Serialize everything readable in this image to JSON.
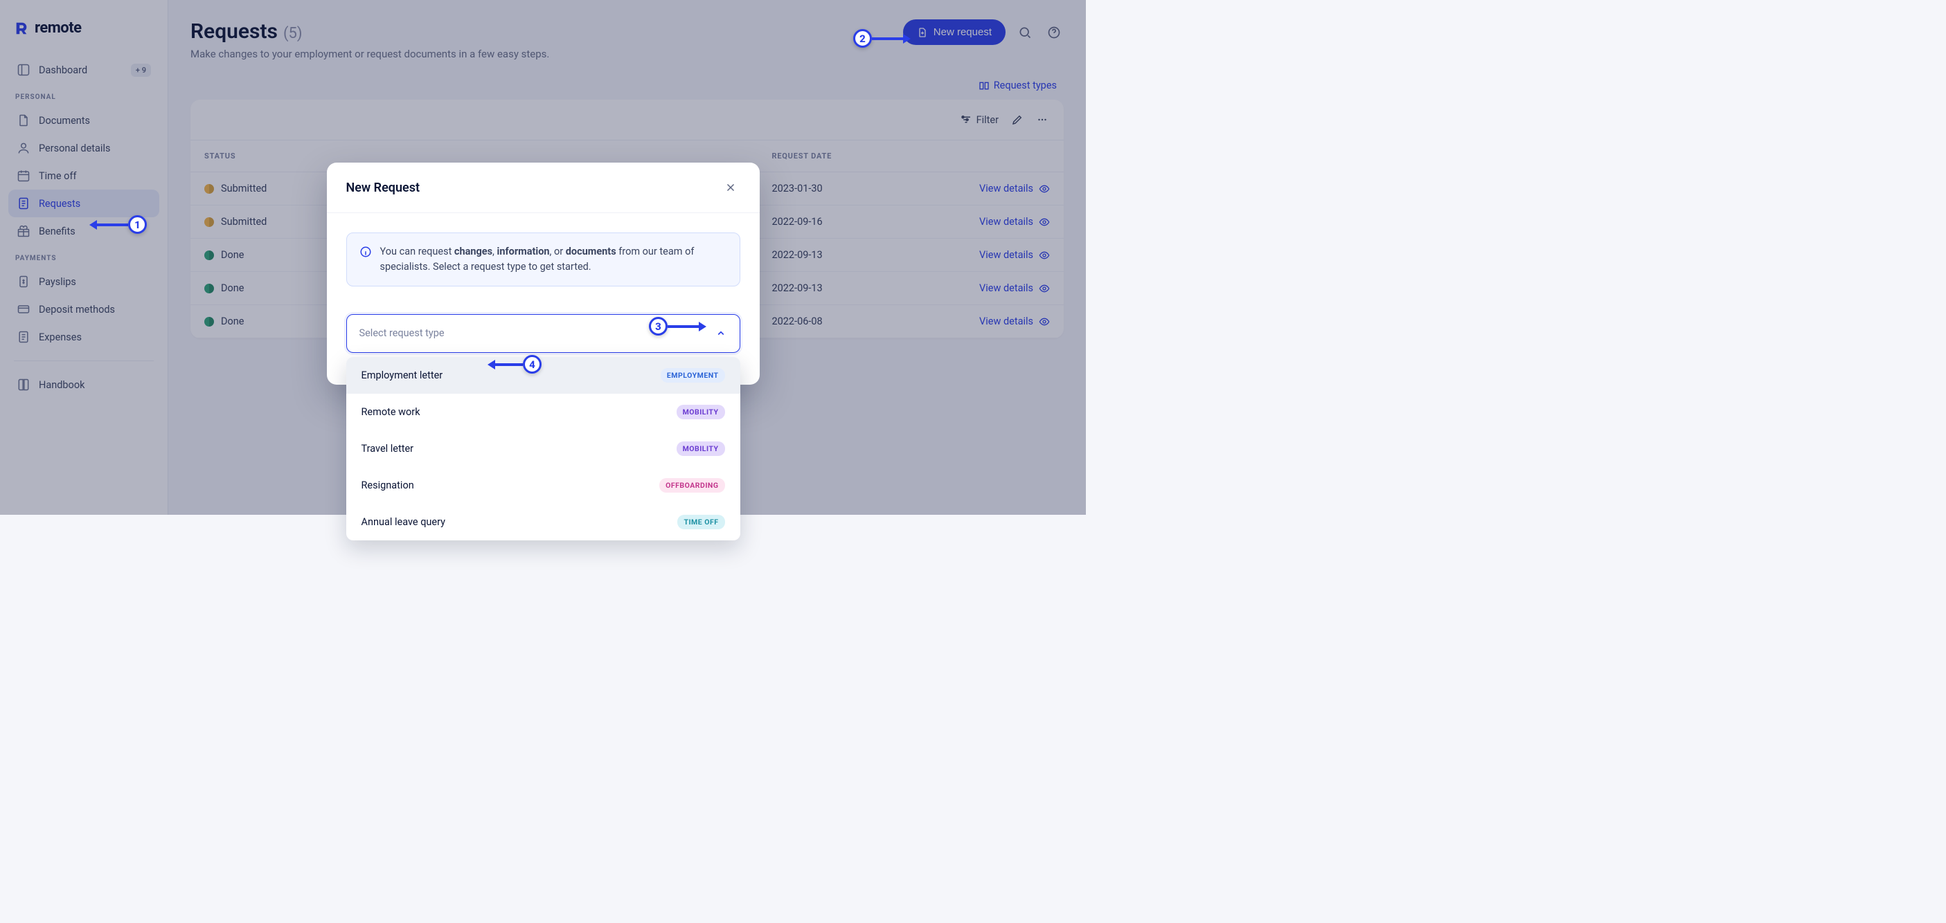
{
  "brand": {
    "name": "remote"
  },
  "sidebar": {
    "items": [
      {
        "label": "Dashboard",
        "badge": "+ 9"
      },
      {
        "section": "PERSONAL"
      },
      {
        "label": "Documents"
      },
      {
        "label": "Personal details"
      },
      {
        "label": "Time off"
      },
      {
        "label": "Requests",
        "active": true
      },
      {
        "label": "Benefits"
      },
      {
        "section": "PAYMENTS"
      },
      {
        "label": "Payslips"
      },
      {
        "label": "Deposit methods"
      },
      {
        "label": "Expenses"
      },
      {
        "divider": true
      },
      {
        "label": "Handbook"
      }
    ]
  },
  "page": {
    "title": "Requests",
    "count": "(5)",
    "subtitle": "Make changes to your employment or request documents in a few easy steps.",
    "new_request_label": "New request",
    "request_types_label": "Request types",
    "filter_label": "Filter",
    "columns": {
      "status": "STATUS",
      "request_date": "REQUEST DATE"
    },
    "view_details_label": "View details",
    "rows": [
      {
        "status": "Submitted",
        "status_kind": "submitted",
        "date": "2023-01-30"
      },
      {
        "status": "Submitted",
        "status_kind": "submitted",
        "date": "2022-09-16"
      },
      {
        "status": "Done",
        "status_kind": "done",
        "date": "2022-09-13"
      },
      {
        "status": "Done",
        "status_kind": "done",
        "date": "2022-09-13"
      },
      {
        "status": "Done",
        "status_kind": "done",
        "date": "2022-06-08"
      }
    ]
  },
  "modal": {
    "title": "New Request",
    "info_prefix": "You can request ",
    "info_b1": "changes",
    "info_sep1": ", ",
    "info_b2": "information",
    "info_sep2": ", or ",
    "info_b3": "documents",
    "info_suffix": " from our team of specialists. Select a request type to get started.",
    "select_placeholder": "Select request type",
    "options": [
      {
        "label": "Employment letter",
        "tag": "EMPLOYMENT",
        "tag_class": "employment",
        "hover": true
      },
      {
        "label": "Remote work",
        "tag": "MOBILITY",
        "tag_class": "mobility"
      },
      {
        "label": "Travel letter",
        "tag": "MOBILITY",
        "tag_class": "mobility"
      },
      {
        "label": "Resignation",
        "tag": "OFFBOARDING",
        "tag_class": "offboarding"
      },
      {
        "label": "Annual leave query",
        "tag": "TIME OFF",
        "tag_class": "timeoff"
      }
    ]
  },
  "annotations": {
    "a1": "1",
    "a2": "2",
    "a3": "3",
    "a4": "4"
  }
}
